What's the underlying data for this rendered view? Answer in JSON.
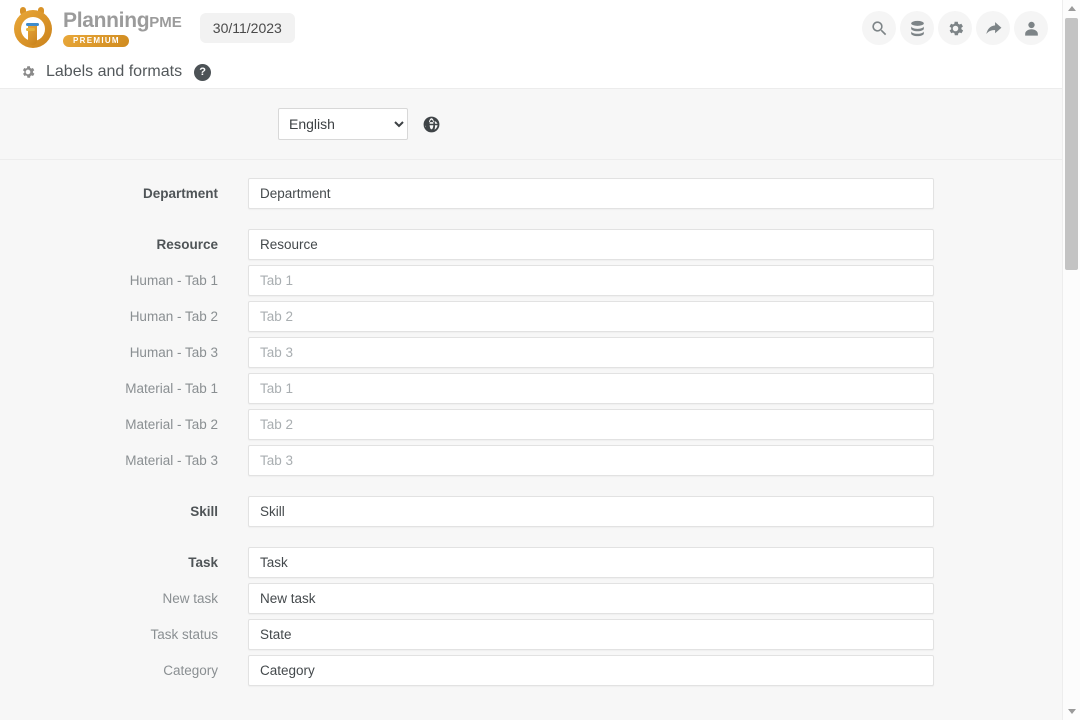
{
  "app": {
    "brand_name": "Planning",
    "brand_suffix": "PME",
    "brand_badge": "PREMIUM",
    "date": "30/11/2023"
  },
  "topbar": {
    "icons": [
      {
        "name": "search-icon",
        "label": "Search"
      },
      {
        "name": "database-icon",
        "label": "Database"
      },
      {
        "name": "gear-icon",
        "label": "Settings"
      },
      {
        "name": "share-icon",
        "label": "Share"
      },
      {
        "name": "user-icon",
        "label": "Account"
      }
    ]
  },
  "page": {
    "title": "Labels and formats",
    "title_icon": "gear-icon",
    "help_label": "?"
  },
  "language": {
    "selected": "English",
    "options": [
      "English"
    ],
    "globe_icon": "globe-icon"
  },
  "form": {
    "rows": [
      {
        "label": "Department",
        "value": "Department",
        "bold": true,
        "placeholder": false,
        "group_start": false
      },
      {
        "label": "Resource",
        "value": "Resource",
        "bold": true,
        "placeholder": false,
        "group_start": true
      },
      {
        "label": "Human - Tab 1",
        "value": "Tab 1",
        "bold": false,
        "placeholder": true,
        "group_start": false
      },
      {
        "label": "Human - Tab 2",
        "value": "Tab 2",
        "bold": false,
        "placeholder": true,
        "group_start": false
      },
      {
        "label": "Human - Tab 3",
        "value": "Tab 3",
        "bold": false,
        "placeholder": true,
        "group_start": false
      },
      {
        "label": "Material - Tab 1",
        "value": "Tab 1",
        "bold": false,
        "placeholder": true,
        "group_start": false
      },
      {
        "label": "Material - Tab 2",
        "value": "Tab 2",
        "bold": false,
        "placeholder": true,
        "group_start": false
      },
      {
        "label": "Material - Tab 3",
        "value": "Tab 3",
        "bold": false,
        "placeholder": true,
        "group_start": false
      },
      {
        "label": "Skill",
        "value": "Skill",
        "bold": true,
        "placeholder": false,
        "group_start": true
      },
      {
        "label": "Task",
        "value": "Task",
        "bold": true,
        "placeholder": false,
        "group_start": true
      },
      {
        "label": "New task",
        "value": "New task",
        "bold": false,
        "placeholder": false,
        "group_start": false
      },
      {
        "label": "Task status",
        "value": "State",
        "bold": false,
        "placeholder": false,
        "group_start": false
      },
      {
        "label": "Category",
        "value": "Category",
        "bold": false,
        "placeholder": false,
        "group_start": false
      }
    ]
  },
  "scrollbar": {
    "up_arrow": "chevron-up-icon",
    "down_arrow": "chevron-down-icon"
  },
  "colors": {
    "brand_orange": "#d99328",
    "page_bg": "#f7f7f7",
    "header_bg": "#ffffff",
    "label_muted": "#8a8f92",
    "label_strong": "#4f5457",
    "value_text": "#44494c",
    "placeholder_text": "#a9aeb1"
  }
}
